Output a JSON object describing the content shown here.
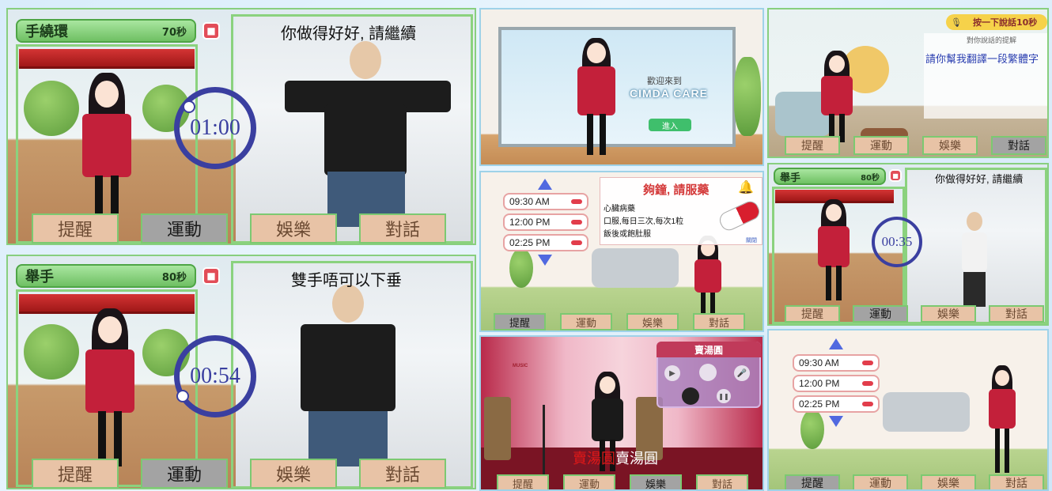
{
  "panels": {
    "p1": {
      "exercise": "手繞環",
      "seconds": "70秒",
      "timer": "01:00",
      "message": "你做得好好, 請繼續"
    },
    "p2": {
      "exercise": "舉手",
      "seconds": "80秒",
      "timer": "00:54",
      "message": "雙手唔可以下垂"
    },
    "p3": {
      "welcome": "歡迎來到",
      "brand": "CIMDA CARE",
      "enter": "進入"
    },
    "p4": {
      "hint_button": "按一下說話10秒",
      "hint_sub": "對你說話的提解",
      "speech": "請你幫我翻譯一段繁體字"
    },
    "p5": {
      "alarms": [
        "09:30 AM",
        "12:00 PM",
        "02:25 PM"
      ],
      "notice_title": "夠鐘, 請服藥",
      "med_lines": [
        "心臟病藥",
        "口服,每日三次,每次1粒",
        "飯後或飽肚服"
      ],
      "close": "關閉"
    },
    "p6": {
      "exercise": "舉手",
      "seconds": "80秒",
      "timer": "00:35",
      "message": "你做得好好, 請繼續"
    },
    "p7": {
      "song_title": "賣湯圓",
      "logo": "MUSIC",
      "lyric_sung": "賣湯圓",
      "lyric_rest": "賣湯圓"
    },
    "p8": {
      "alarms": [
        "09:30 AM",
        "12:00 PM",
        "02:25 PM"
      ]
    }
  },
  "menu": {
    "remind": "提醒",
    "exercise": "運動",
    "entertain": "娛樂",
    "chat": "對話"
  },
  "colors": {
    "accent_green": "#88cf7f",
    "timer_blue": "#3a3fa0",
    "alarm_red": "#e23d4b",
    "menu_button": "#e8c3a6"
  }
}
